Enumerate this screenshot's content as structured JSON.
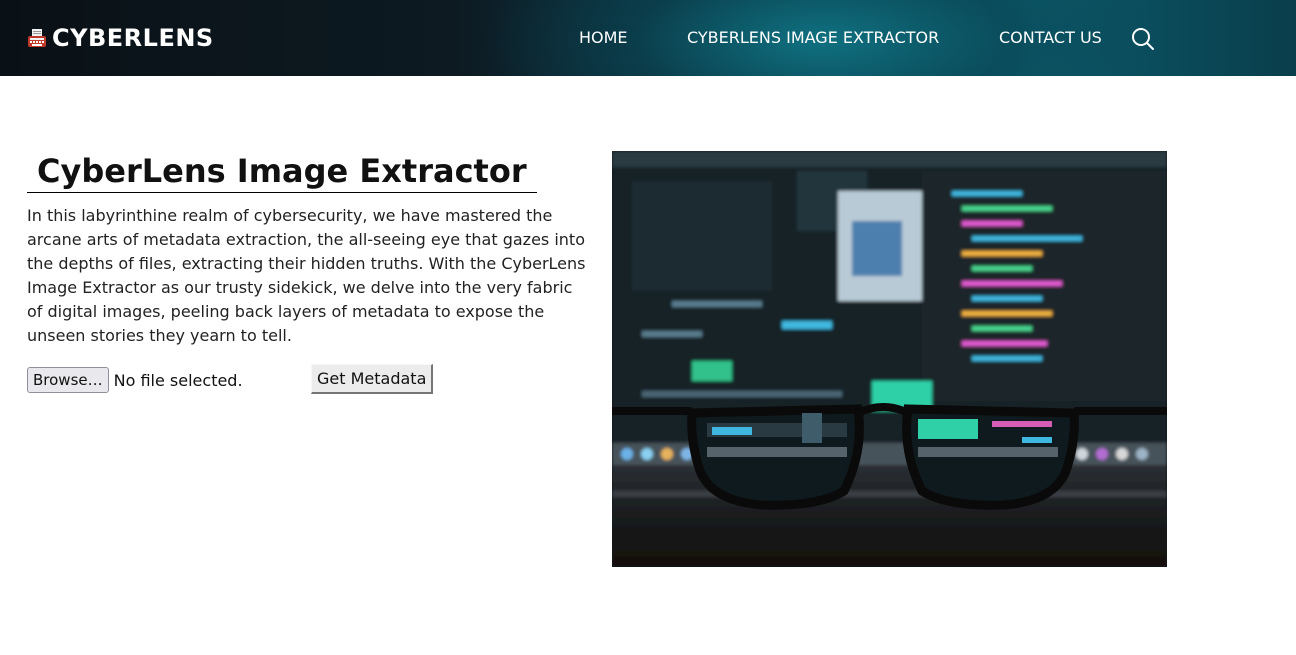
{
  "header": {
    "logo_text": "CYBERLENS",
    "nav": [
      {
        "label": "HOME"
      },
      {
        "label": "CYBERLENS IMAGE EXTRACTOR"
      },
      {
        "label": "CONTACT US"
      }
    ],
    "icons": {
      "logo": "typewriter-icon",
      "search": "search-icon"
    }
  },
  "main": {
    "title": "CyberLens Image Extractor",
    "description": "In this labyrinthine realm of cybersecurity, we have mastered the arcane arts of metadata extraction, the all-seeing eye that gazes into the depths of files, extracting their hidden truths. With the CyberLens Image Extractor as our trusty sidekick, we delve into the very fabric of digital images, peeling back layers of metadata to expose the unseen stories they yearn to tell.",
    "file_input": {
      "browse_label": "Browse…",
      "status": "No file selected."
    },
    "submit_label": "Get Metadata"
  },
  "colors": {
    "header_dark": "#0a1116",
    "header_teal": "#0b5868",
    "text": "#222222"
  }
}
